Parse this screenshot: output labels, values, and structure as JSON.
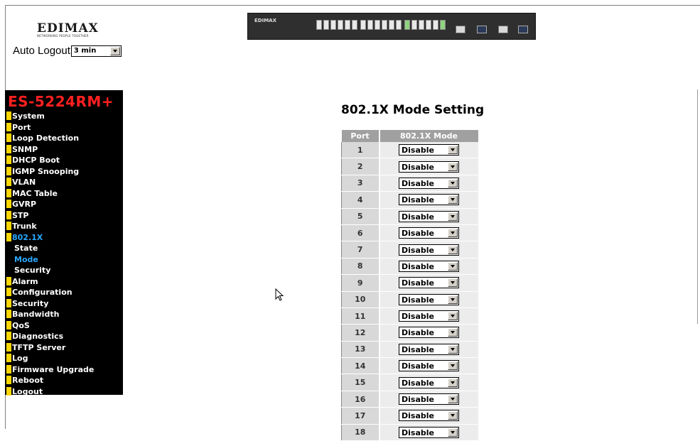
{
  "brand": {
    "name": "EDIMAX",
    "tagline": "NETWORKING PEOPLE TOGETHER"
  },
  "autologout": {
    "label": "Auto Logout",
    "value": "3 min"
  },
  "switch_image": {
    "brand": "EDIMAX"
  },
  "sidebar": {
    "model": "ES-5224RM+",
    "items": [
      {
        "label": "System",
        "sub": false,
        "active": false
      },
      {
        "label": "Port",
        "sub": false,
        "active": false
      },
      {
        "label": "Loop Detection",
        "sub": false,
        "active": false
      },
      {
        "label": "SNMP",
        "sub": false,
        "active": false
      },
      {
        "label": "DHCP Boot",
        "sub": false,
        "active": false
      },
      {
        "label": "IGMP Snooping",
        "sub": false,
        "active": false
      },
      {
        "label": "VLAN",
        "sub": false,
        "active": false
      },
      {
        "label": "MAC Table",
        "sub": false,
        "active": false
      },
      {
        "label": "GVRP",
        "sub": false,
        "active": false
      },
      {
        "label": "STP",
        "sub": false,
        "active": false
      },
      {
        "label": "Trunk",
        "sub": false,
        "active": false
      },
      {
        "label": "802.1X",
        "sub": false,
        "active": true
      },
      {
        "label": "State",
        "sub": true,
        "active": false
      },
      {
        "label": "Mode",
        "sub": true,
        "active": true
      },
      {
        "label": "Security",
        "sub": true,
        "active": false
      },
      {
        "label": "Alarm",
        "sub": false,
        "active": false
      },
      {
        "label": "Configuration",
        "sub": false,
        "active": false
      },
      {
        "label": "Security",
        "sub": false,
        "active": false
      },
      {
        "label": "Bandwidth",
        "sub": false,
        "active": false
      },
      {
        "label": "QoS",
        "sub": false,
        "active": false
      },
      {
        "label": "Diagnostics",
        "sub": false,
        "active": false
      },
      {
        "label": "TFTP Server",
        "sub": false,
        "active": false
      },
      {
        "label": "Log",
        "sub": false,
        "active": false
      },
      {
        "label": "Firmware Upgrade",
        "sub": false,
        "active": false
      },
      {
        "label": "Reboot",
        "sub": false,
        "active": false
      },
      {
        "label": "Logout",
        "sub": false,
        "active": false
      }
    ]
  },
  "main": {
    "title": "802.1X Mode Setting",
    "columns": [
      "Port",
      "802.1X Mode"
    ],
    "rows": [
      {
        "port": "1",
        "mode": "Disable"
      },
      {
        "port": "2",
        "mode": "Disable"
      },
      {
        "port": "3",
        "mode": "Disable"
      },
      {
        "port": "4",
        "mode": "Disable"
      },
      {
        "port": "5",
        "mode": "Disable"
      },
      {
        "port": "6",
        "mode": "Disable"
      },
      {
        "port": "7",
        "mode": "Disable"
      },
      {
        "port": "8",
        "mode": "Disable"
      },
      {
        "port": "9",
        "mode": "Disable"
      },
      {
        "port": "10",
        "mode": "Disable"
      },
      {
        "port": "11",
        "mode": "Disable"
      },
      {
        "port": "12",
        "mode": "Disable"
      },
      {
        "port": "13",
        "mode": "Disable"
      },
      {
        "port": "14",
        "mode": "Disable"
      },
      {
        "port": "15",
        "mode": "Disable"
      },
      {
        "port": "16",
        "mode": "Disable"
      },
      {
        "port": "17",
        "mode": "Disable"
      },
      {
        "port": "18",
        "mode": "Disable"
      }
    ]
  },
  "colors": {
    "sidebar_bg": "#000000",
    "model_text": "#ff2020",
    "menu_marker": "#ffd700",
    "active_item": "#2aa8ff",
    "table_header": "#a0a0a0"
  }
}
